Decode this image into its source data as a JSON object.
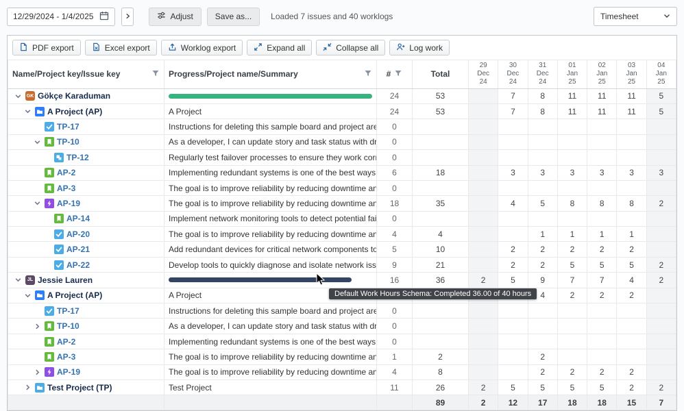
{
  "toolbar": {
    "date_range": "12/29/2024 - 1/4/2025",
    "next_period": "›",
    "adjust_label": "Adjust",
    "save_as_label": "Save as...",
    "loaded_text": "Loaded 7 issues and 40 worklogs",
    "view_selector": "Timesheet"
  },
  "actions": {
    "pdf_export": "PDF export",
    "excel_export": "Excel export",
    "worklog_export": "Worklog export",
    "expand_all": "Expand all",
    "collapse_all": "Collapse all",
    "log_work": "Log work"
  },
  "table": {
    "headers": {
      "name": "Name/Project key/Issue key",
      "progress": "Progress/Project name/Summary",
      "count": "#",
      "total": "Total",
      "days": [
        "29\nDec\n24",
        "30\nDec\n24",
        "31\nDec\n24",
        "01\nJan\n25",
        "02\nJan\n25",
        "03\nJan\n25",
        "04\nJan\n25"
      ]
    },
    "weekend_columns": [
      0,
      6
    ],
    "rows": [
      {
        "type": "user",
        "level": 0,
        "chevron": "down",
        "icon": {
          "kind": "avatar",
          "color": "#c96b2f",
          "initials": "GK"
        },
        "label": "Gökçe Karaduman",
        "summary": "",
        "progress": {
          "pct": 100,
          "color": "#36b37e"
        },
        "count": "24",
        "total": "53",
        "days": [
          "",
          "7",
          "8",
          "11",
          "11",
          "11",
          "5"
        ]
      },
      {
        "type": "project",
        "level": 1,
        "chevron": "down",
        "icon": {
          "kind": "project",
          "color": "#2d7ff9"
        },
        "label": "A Project (AP)",
        "summary": "A Project",
        "progress": null,
        "count": "24",
        "total": "53",
        "days": [
          "",
          "7",
          "8",
          "11",
          "11",
          "11",
          "5"
        ]
      },
      {
        "type": "issue",
        "level": 2,
        "chevron": null,
        "icon": {
          "kind": "task",
          "color": "#4bade8"
        },
        "label": "TP-17",
        "summary": "Instructions for deleting this sample board and project are in the descrip...",
        "progress": null,
        "count": "0",
        "total": "",
        "days": [
          "",
          "",
          "",
          "",
          "",
          "",
          ""
        ]
      },
      {
        "type": "issue",
        "level": 2,
        "chevron": "down",
        "icon": {
          "kind": "story",
          "color": "#63ba3c"
        },
        "label": "TP-10",
        "summary": "As a developer, I can update story and task status with drag and drop (cl...",
        "progress": null,
        "count": "0",
        "total": "",
        "days": [
          "",
          "",
          "",
          "",
          "",
          "",
          ""
        ]
      },
      {
        "type": "issue",
        "level": 3,
        "chevron": null,
        "icon": {
          "kind": "subtask",
          "color": "#4bade8"
        },
        "label": "TP-12",
        "summary": "Regularly test failover processes to ensure they work correctly during sys...",
        "progress": null,
        "count": "0",
        "total": "",
        "days": [
          "",
          "",
          "",
          "",
          "",
          "",
          ""
        ]
      },
      {
        "type": "issue",
        "level": 2,
        "chevron": null,
        "icon": {
          "kind": "story",
          "color": "#63ba3c"
        },
        "label": "AP-2",
        "summary": "Implementing redundant systems is one of the best ways to improve reli...",
        "progress": null,
        "count": "6",
        "total": "18",
        "days": [
          "",
          "3",
          "3",
          "3",
          "3",
          "3",
          "3"
        ]
      },
      {
        "type": "issue",
        "level": 2,
        "chevron": null,
        "icon": {
          "kind": "story",
          "color": "#63ba3c"
        },
        "label": "AP-3",
        "summary": "The goal is to improve reliability by reducing downtime and enhancing f...",
        "progress": null,
        "count": "0",
        "total": "",
        "days": [
          "",
          "",
          "",
          "",
          "",
          "",
          ""
        ]
      },
      {
        "type": "issue",
        "level": 2,
        "chevron": "down",
        "icon": {
          "kind": "epic",
          "color": "#904ee2"
        },
        "label": "AP-19",
        "summary": "The goal is to improve reliability by reducing downtime and enhancing f...",
        "progress": null,
        "count": "18",
        "total": "35",
        "days": [
          "",
          "4",
          "5",
          "8",
          "8",
          "8",
          "2"
        ]
      },
      {
        "type": "issue",
        "level": 3,
        "chevron": null,
        "icon": {
          "kind": "story",
          "color": "#63ba3c"
        },
        "label": "AP-14",
        "summary": "Implement network monitoring tools to detect potential failures early, e...",
        "progress": null,
        "count": "0",
        "total": "",
        "days": [
          "",
          "",
          "",
          "",
          "",
          "",
          ""
        ]
      },
      {
        "type": "issue",
        "level": 3,
        "chevron": null,
        "icon": {
          "kind": "task",
          "color": "#4bade8"
        },
        "label": "AP-20",
        "summary": "The goal is to improve reliability by reducing downtime and enhancing f...",
        "progress": null,
        "count": "4",
        "total": "4",
        "days": [
          "",
          "",
          "1",
          "1",
          "1",
          "1",
          ""
        ]
      },
      {
        "type": "issue",
        "level": 3,
        "chevron": null,
        "icon": {
          "kind": "task",
          "color": "#4bade8"
        },
        "label": "AP-21",
        "summary": "Add redundant devices for critical network components to ensure reliab...",
        "progress": null,
        "count": "5",
        "total": "10",
        "days": [
          "",
          "2",
          "2",
          "2",
          "2",
          "2",
          ""
        ]
      },
      {
        "type": "issue",
        "level": 3,
        "chevron": null,
        "icon": {
          "kind": "task",
          "color": "#4bade8"
        },
        "label": "AP-22",
        "summary": "Develop tools to quickly diagnose and isolate network issues.",
        "progress": null,
        "count": "9",
        "total": "21",
        "days": [
          "",
          "2",
          "2",
          "5",
          "5",
          "5",
          "2"
        ]
      },
      {
        "type": "user",
        "level": 0,
        "chevron": "down",
        "icon": {
          "kind": "avatar",
          "color": "#5d4a66",
          "initials": "JL"
        },
        "label": "Jessie Lauren",
        "summary": "",
        "progress": {
          "pct": 90,
          "color": "#344563"
        },
        "count": "16",
        "total": "36",
        "days": [
          "2",
          "5",
          "9",
          "7",
          "7",
          "4",
          "2"
        ]
      },
      {
        "type": "project",
        "level": 1,
        "chevron": "down",
        "icon": {
          "kind": "project",
          "color": "#2d7ff9"
        },
        "label": "A Project (AP)",
        "summary": "A Project",
        "progress": null,
        "count": "",
        "total": "",
        "days": [
          "",
          "",
          "4",
          "2",
          "2",
          "2",
          ""
        ]
      },
      {
        "type": "issue",
        "level": 2,
        "chevron": null,
        "icon": {
          "kind": "task",
          "color": "#4bade8"
        },
        "label": "TP-17",
        "summary": "Instructions for deleting this sample board and project are in the descrip...",
        "progress": null,
        "count": "0",
        "total": "",
        "days": [
          "",
          "",
          "",
          "",
          "",
          "",
          ""
        ]
      },
      {
        "type": "issue",
        "level": 2,
        "chevron": "right",
        "icon": {
          "kind": "story",
          "color": "#63ba3c"
        },
        "label": "TP-10",
        "summary": "As a developer, I can update story and task status with drag and drop (cl...",
        "progress": null,
        "count": "0",
        "total": "",
        "days": [
          "",
          "",
          "",
          "",
          "",
          "",
          ""
        ]
      },
      {
        "type": "issue",
        "level": 2,
        "chevron": null,
        "icon": {
          "kind": "story",
          "color": "#63ba3c"
        },
        "label": "AP-2",
        "summary": "Implementing redundant systems is one of the best ways to improve reli...",
        "progress": null,
        "count": "0",
        "total": "",
        "days": [
          "",
          "",
          "",
          "",
          "",
          "",
          ""
        ]
      },
      {
        "type": "issue",
        "level": 2,
        "chevron": null,
        "icon": {
          "kind": "story",
          "color": "#63ba3c"
        },
        "label": "AP-3",
        "summary": "The goal is to improve reliability by reducing downtime and enhancing f...",
        "progress": null,
        "count": "1",
        "total": "2",
        "days": [
          "",
          "",
          "2",
          "",
          "",
          "",
          ""
        ]
      },
      {
        "type": "issue",
        "level": 2,
        "chevron": "right",
        "icon": {
          "kind": "epic",
          "color": "#904ee2"
        },
        "label": "AP-19",
        "summary": "The goal is to improve reliability by reducing downtime and enhancing f...",
        "progress": null,
        "count": "4",
        "total": "8",
        "days": [
          "",
          "",
          "2",
          "2",
          "2",
          "2",
          ""
        ]
      },
      {
        "type": "project",
        "level": 1,
        "chevron": "right",
        "icon": {
          "kind": "project",
          "color": "#4bade8"
        },
        "label": "Test Project (TP)",
        "summary": "Test Project",
        "progress": null,
        "count": "11",
        "total": "26",
        "days": [
          "2",
          "5",
          "5",
          "5",
          "5",
          "2",
          "2"
        ]
      }
    ],
    "footer": {
      "total": "89",
      "days": [
        "2",
        "12",
        "17",
        "18",
        "18",
        "15",
        "7"
      ]
    }
  },
  "tooltip": {
    "text": "Default Work Hours Schema: Completed 36.00 of 40 hours"
  },
  "colors": {
    "progress_complete": "#36b37e",
    "progress_partial": "#344563",
    "issue_link": "#3572b0"
  }
}
